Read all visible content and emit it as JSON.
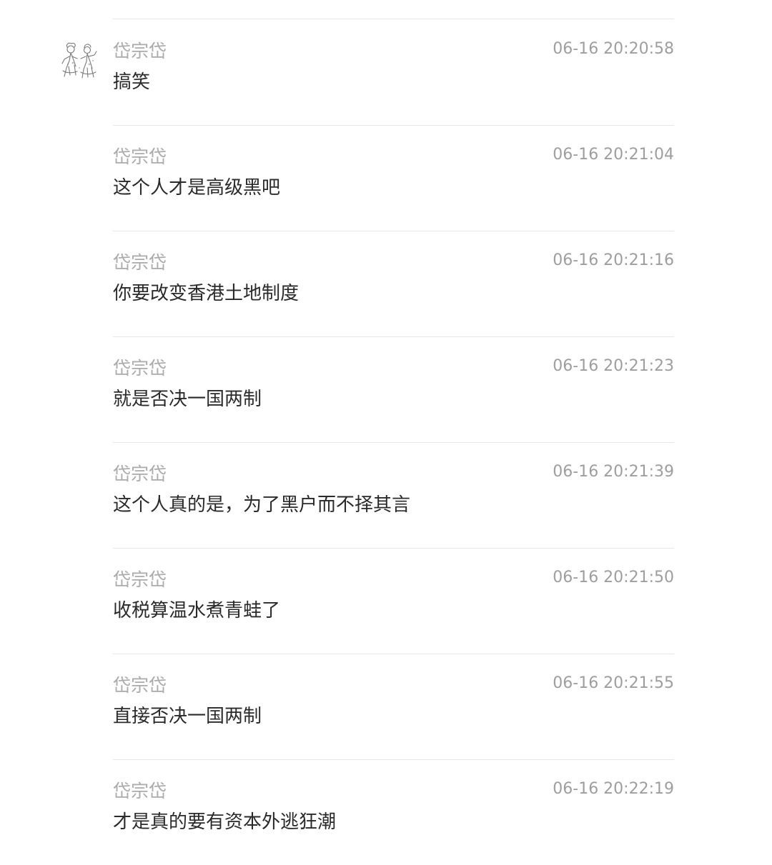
{
  "messages": [
    {
      "sender": "岱宗岱",
      "time": "06-16 20:20:58",
      "text": "搞笑",
      "has_avatar": true
    },
    {
      "sender": "岱宗岱",
      "time": "06-16 20:21:04",
      "text": "这个人才是高级黑吧",
      "has_avatar": false
    },
    {
      "sender": "岱宗岱",
      "time": "06-16 20:21:16",
      "text": "你要改变香港土地制度",
      "has_avatar": false
    },
    {
      "sender": "岱宗岱",
      "time": "06-16 20:21:23",
      "text": "就是否决一国两制",
      "has_avatar": false
    },
    {
      "sender": "岱宗岱",
      "time": "06-16 20:21:39",
      "text": "这个人真的是，为了黑户而不择其言",
      "has_avatar": false
    },
    {
      "sender": "岱宗岱",
      "time": "06-16 20:21:50",
      "text": "收税算温水煮青蛙了",
      "has_avatar": false
    },
    {
      "sender": "岱宗岱",
      "time": "06-16 20:21:55",
      "text": "直接否决一国两制",
      "has_avatar": false
    },
    {
      "sender": "岱宗岱",
      "time": "06-16 20:22:19",
      "text": "才是真的要有资本外逃狂潮",
      "has_avatar": false
    }
  ],
  "colors": {
    "sender": "#ababab",
    "timestamp": "#9e9e9e",
    "text": "#2a2a2a",
    "divider": "#e6e6e6"
  },
  "icons": {
    "avatar": "sketch-figures-avatar-icon"
  }
}
